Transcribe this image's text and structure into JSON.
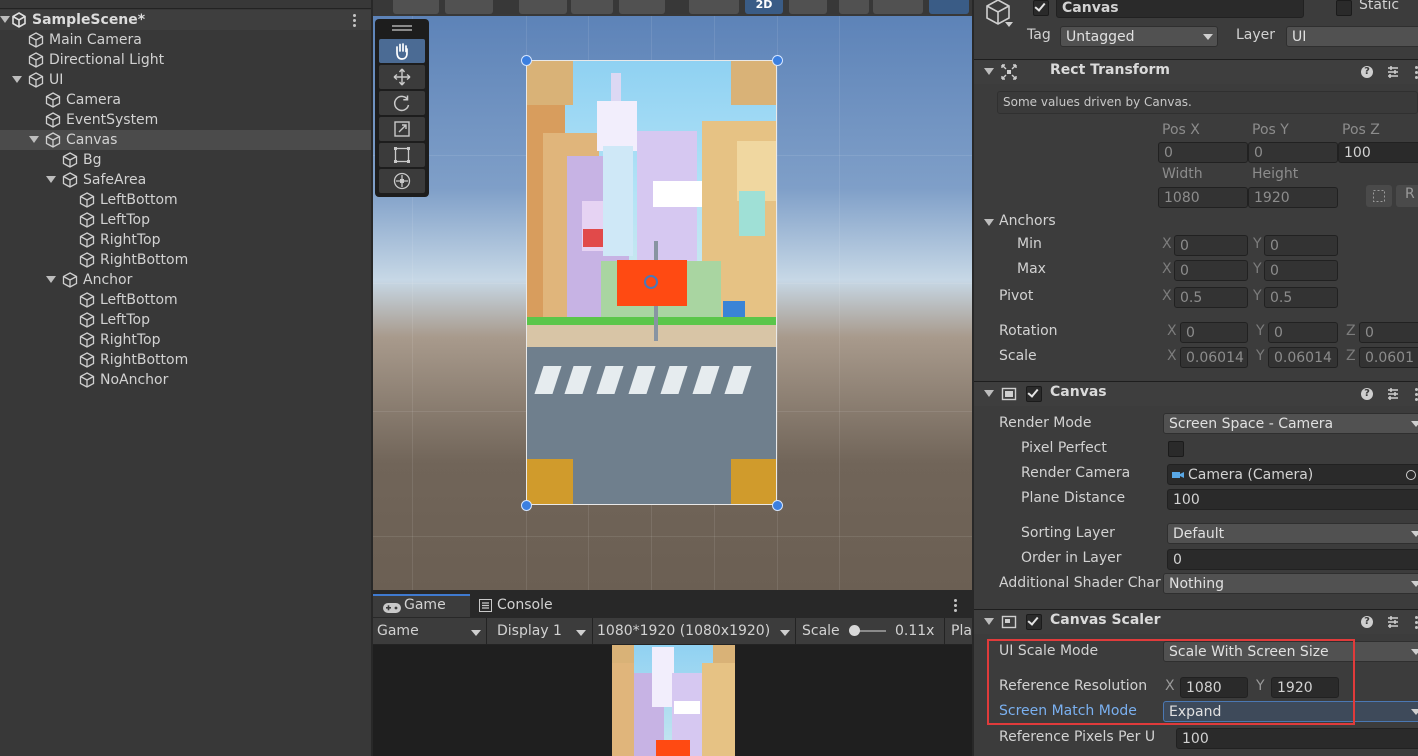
{
  "hierarchy": {
    "scene_name": "SampleScene*",
    "items": [
      {
        "label": "Main Camera"
      },
      {
        "label": "Directional Light"
      },
      {
        "label": "UI"
      },
      {
        "label": "Camera"
      },
      {
        "label": "EventSystem"
      },
      {
        "label": "Canvas"
      },
      {
        "label": "Bg"
      },
      {
        "label": "SafeArea"
      },
      {
        "label": "LeftBottom"
      },
      {
        "label": "LeftTop"
      },
      {
        "label": "RightTop"
      },
      {
        "label": "RightBottom"
      },
      {
        "label": "Anchor"
      },
      {
        "label": "LeftBottom"
      },
      {
        "label": "LeftTop"
      },
      {
        "label": "RightTop"
      },
      {
        "label": "RightBottom"
      },
      {
        "label": "NoAnchor"
      }
    ]
  },
  "scene_toolbar": {
    "mode_2d": "2D"
  },
  "game_panel": {
    "tabs": [
      {
        "label": "Game"
      },
      {
        "label": "Console"
      }
    ],
    "view_select": "Game",
    "display": "Display 1",
    "resolution": "1080*1920 (1080x1920)",
    "scale_label": "Scale",
    "scale_value": "0.11x",
    "scale_fraction": 0.1,
    "play_cut": "Pla"
  },
  "inspector": {
    "object_name": "Canvas",
    "static_label": "Static",
    "tag_label": "Tag",
    "tag_value": "Untagged",
    "layer_label": "Layer",
    "layer_value": "UI",
    "rect_transform": {
      "title": "Rect Transform",
      "note": "Some values driven by Canvas.",
      "pos_x_label": "Pos X",
      "pos_y_label": "Pos Y",
      "pos_z_label": "Pos Z",
      "pos_x": "0",
      "pos_y": "0",
      "pos_z": "100",
      "width_label": "Width",
      "height_label": "Height",
      "width": "1080",
      "height": "1920",
      "r_button": "R",
      "anchors_label": "Anchors",
      "min_label": "Min",
      "max_label": "Max",
      "min_x": "0",
      "min_y": "0",
      "max_x": "0",
      "max_y": "0",
      "pivot_label": "Pivot",
      "pivot_x": "0.5",
      "pivot_y": "0.5",
      "rotation_label": "Rotation",
      "rot_x": "0",
      "rot_y": "0",
      "rot_z": "0",
      "scale_label": "Scale",
      "scale_x": "0.06014",
      "scale_y": "0.06014",
      "scale_z": "0.0601",
      "axis_x": "X",
      "axis_y": "Y",
      "axis_z": "Z"
    },
    "canvas": {
      "title": "Canvas",
      "render_mode_label": "Render Mode",
      "render_mode": "Screen Space - Camera",
      "pixel_perfect_label": "Pixel Perfect",
      "render_camera_label": "Render Camera",
      "render_camera": "Camera (Camera)",
      "plane_distance_label": "Plane Distance",
      "plane_distance": "100",
      "sorting_layer_label": "Sorting Layer",
      "sorting_layer": "Default",
      "order_in_layer_label": "Order in Layer",
      "order_in_layer": "0",
      "shader_channels_label": "Additional Shader Char",
      "shader_channels": "Nothing"
    },
    "canvas_scaler": {
      "title": "Canvas Scaler",
      "ui_scale_mode_label": "UI Scale Mode",
      "ui_scale_mode": "Scale With Screen Size",
      "ref_res_label": "Reference Resolution",
      "ref_x": "1080",
      "ref_y": "1920",
      "match_mode_label": "Screen Match Mode",
      "match_mode": "Expand",
      "ref_ppu_label": "Reference Pixels Per U",
      "ref_ppu": "100"
    }
  },
  "colors": {
    "accent": "#3f7ad0",
    "highlight": "#e03b3b",
    "orange": "#ff4a12"
  }
}
